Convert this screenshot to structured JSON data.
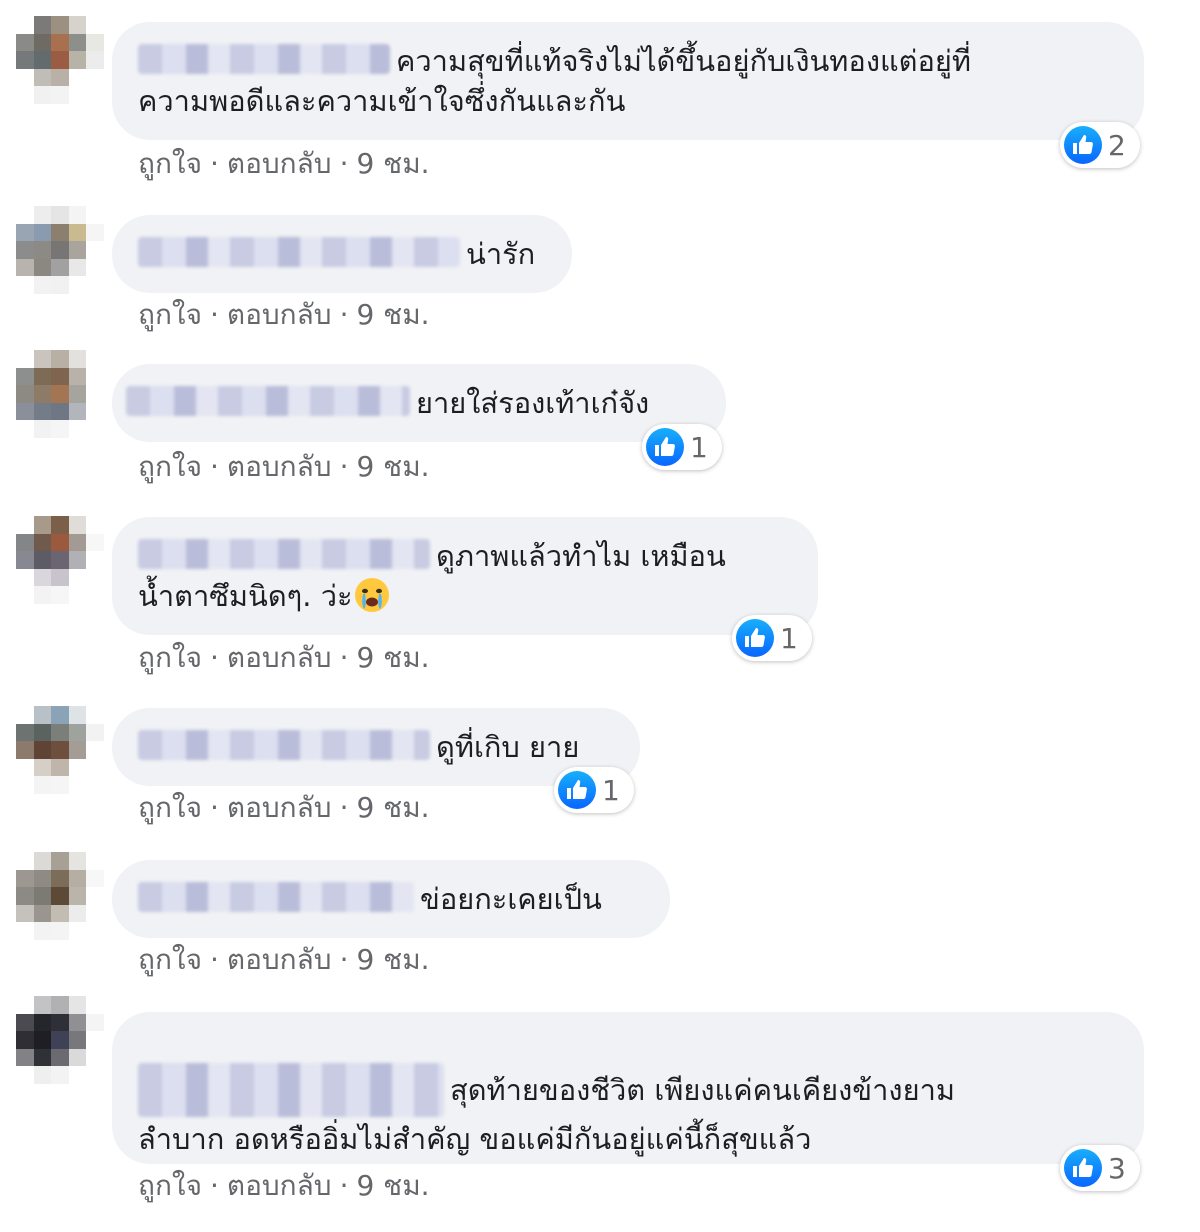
{
  "meta_labels": {
    "like": "ถูกใจ",
    "reply": "ตอบกลับ",
    "time": "9 ชม.",
    "separator": "·"
  },
  "colors": {
    "bubble_bg": "#f0f2f5",
    "meta_text": "#65676b",
    "like_blue": "#0866ff"
  },
  "comments": [
    {
      "line1": "ความสุขที่แท้จริงไม่ได้ขึ้นอยู่กับเงินทองแต่อยู่ที่",
      "line2": "ความพอดีและความเข้าใจซึ่งกันและกัน",
      "likes": "2",
      "author": "blurred-name",
      "avatar": "blurred-avatar"
    },
    {
      "line1": "น่ารัก",
      "author": "blurred-name",
      "avatar": "blurred-avatar"
    },
    {
      "line1": "ยายใส่รองเท้าเก๋จัง",
      "likes": "1",
      "author": "blurred-name",
      "avatar": "blurred-avatar"
    },
    {
      "line1": "ดูภาพแล้วทำไม เหมือน",
      "line2": "น้ำตาซึมนิดๆ. ว่ะ",
      "emoji": "crying-face-emoji",
      "likes": "1",
      "author": "blurred-name",
      "avatar": "blurred-avatar"
    },
    {
      "line1": "ดูที่เกิบ ยาย",
      "likes": "1",
      "author": "blurred-name",
      "avatar": "blurred-avatar"
    },
    {
      "line1": "ข่อยกะเคยเป็น",
      "author": "blurred-name",
      "avatar": "blurred-avatar"
    },
    {
      "line1": "สุดท้ายของชีวิต เพียงแค่คนเคียงข้างยาม",
      "line2": "ลำบาก อดหรืออิ่มไม่สำคัญ ขอแค่มีกันอยู่แค่นี้ก็สุขแล้ว",
      "likes": "3",
      "author": "blurred-name",
      "avatar": "blurred-avatar"
    }
  ]
}
